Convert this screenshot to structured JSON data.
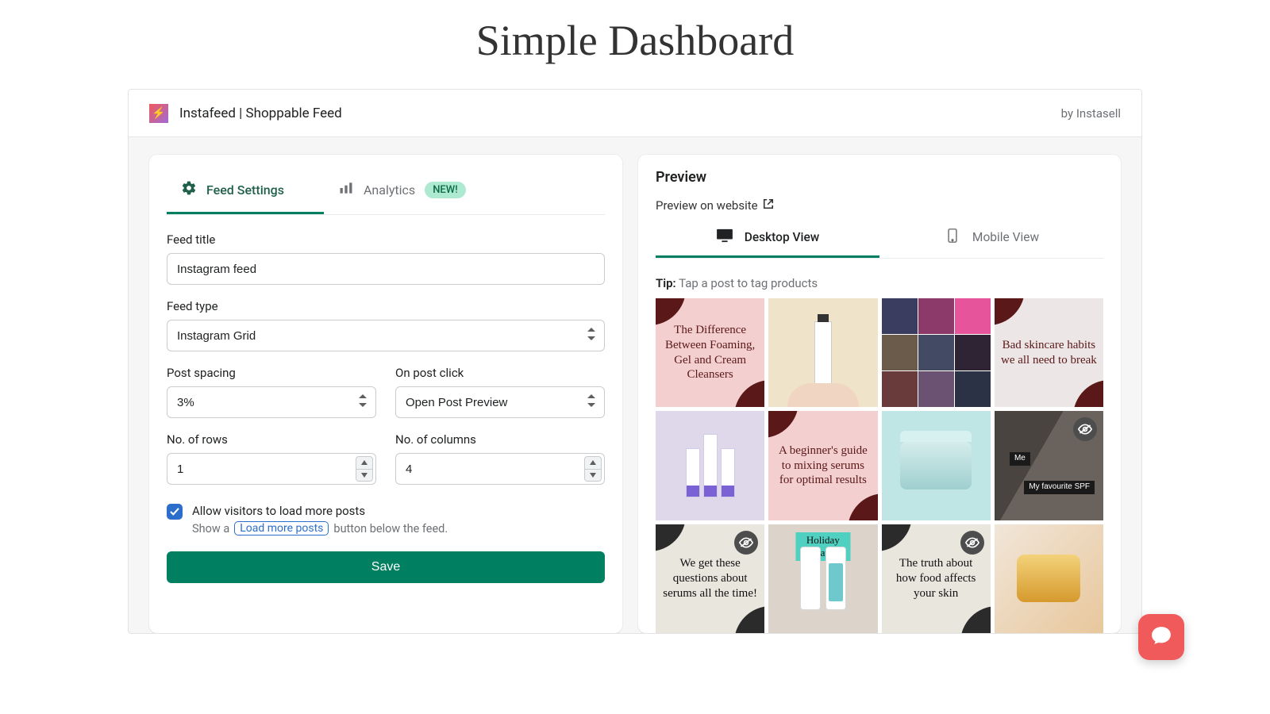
{
  "page_title": "Simple Dashboard",
  "topbar": {
    "app_name": "Instafeed | Shoppable Feed",
    "by_line": "by Instasell"
  },
  "settings": {
    "tabs": {
      "feed_settings": "Feed Settings",
      "analytics": "Analytics",
      "new_badge": "NEW!"
    },
    "labels": {
      "feed_title": "Feed title",
      "feed_type": "Feed type",
      "post_spacing": "Post spacing",
      "on_post_click": "On post click",
      "rows": "No. of rows",
      "cols": "No. of columns"
    },
    "values": {
      "feed_title": "Instagram feed",
      "feed_type": "Instagram Grid",
      "post_spacing": "3%",
      "on_post_click": "Open Post Preview",
      "rows": "1",
      "cols": "4"
    },
    "load_more": {
      "checkbox_label": "Allow visitors to load more posts",
      "help_prefix": "Show a",
      "help_button": "Load more posts",
      "help_suffix": "button below the feed."
    },
    "save_label": "Save"
  },
  "preview": {
    "title": "Preview",
    "website_link": "Preview on website",
    "tabs": {
      "desktop": "Desktop View",
      "mobile": "Mobile View"
    },
    "tip_label": "Tip:",
    "tip_text": "Tap a post to tag products",
    "tiles": [
      {
        "kind": "text-pink",
        "caption": "The Difference Between Foaming, Gel and Cream Cleansers"
      },
      {
        "kind": "product-cream"
      },
      {
        "kind": "collage"
      },
      {
        "kind": "text-white",
        "caption": "Bad skincare habits we all need to break"
      },
      {
        "kind": "tubes"
      },
      {
        "kind": "text-pink",
        "caption": "A beginner's guide to mixing serums for optimal results"
      },
      {
        "kind": "jar-teal"
      },
      {
        "kind": "photo",
        "hidden": true,
        "tag1": "Me",
        "tag2": "My favourite SPF"
      },
      {
        "kind": "text-bone",
        "caption": "We get these questions about serums all the time!",
        "hidden": true
      },
      {
        "kind": "giveaway",
        "banner": "Holiday Giveaway!"
      },
      {
        "kind": "text-bone",
        "caption": "The truth about how food affects your skin",
        "hidden": true
      },
      {
        "kind": "hands-jar"
      }
    ]
  }
}
